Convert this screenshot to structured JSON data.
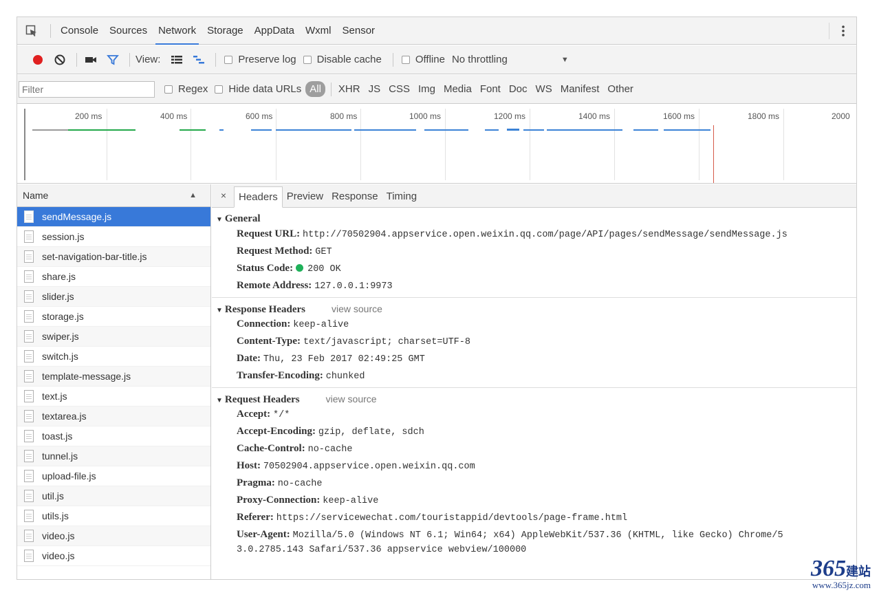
{
  "tabs": [
    {
      "label": "Console"
    },
    {
      "label": "Sources"
    },
    {
      "label": "Network"
    },
    {
      "label": "Storage"
    },
    {
      "label": "AppData"
    },
    {
      "label": "Wxml"
    },
    {
      "label": "Sensor"
    }
  ],
  "toolbar": {
    "view_label": "View:",
    "preserve_log": "Preserve log",
    "disable_cache": "Disable cache",
    "offline": "Offline",
    "throttling": "No throttling"
  },
  "filterbar": {
    "placeholder": "Filter",
    "regex": "Regex",
    "hide_data_urls": "Hide data URLs",
    "types": [
      "All",
      "XHR",
      "JS",
      "CSS",
      "Img",
      "Media",
      "Font",
      "Doc",
      "WS",
      "Manifest",
      "Other"
    ]
  },
  "overview": {
    "ticks": [
      "200 ms",
      "400 ms",
      "600 ms",
      "800 ms",
      "1000 ms",
      "1200 ms",
      "1400 ms",
      "1600 ms",
      "1800 ms",
      "2000"
    ]
  },
  "list": {
    "header": "Name",
    "files": [
      "sendMessage.js",
      "session.js",
      "set-navigation-bar-title.js",
      "share.js",
      "slider.js",
      "storage.js",
      "swiper.js",
      "switch.js",
      "template-message.js",
      "text.js",
      "textarea.js",
      "toast.js",
      "tunnel.js",
      "upload-file.js",
      "util.js",
      "utils.js",
      "video.js",
      "video.js"
    ]
  },
  "details": {
    "tabs": [
      "Headers",
      "Preview",
      "Response",
      "Timing"
    ],
    "general": {
      "title": "General",
      "request_url_key": "Request URL:",
      "request_url": "http://70502904.appservice.open.weixin.qq.com/page/API/pages/sendMessage/sendMessage.js",
      "method_key": "Request Method:",
      "method": "GET",
      "status_key": "Status Code:",
      "status": "200 OK",
      "remote_key": "Remote Address:",
      "remote": "127.0.0.1:9973"
    },
    "response_headers": {
      "title": "Response Headers",
      "view_source": "view source",
      "items": [
        {
          "k": "Connection:",
          "v": "keep-alive"
        },
        {
          "k": "Content-Type:",
          "v": "text/javascript; charset=UTF-8"
        },
        {
          "k": "Date:",
          "v": "Thu, 23 Feb 2017 02:49:25 GMT"
        },
        {
          "k": "Transfer-Encoding:",
          "v": "chunked"
        }
      ]
    },
    "request_headers": {
      "title": "Request Headers",
      "view_source": "view source",
      "items": [
        {
          "k": "Accept:",
          "v": "*/*"
        },
        {
          "k": "Accept-Encoding:",
          "v": "gzip, deflate, sdch"
        },
        {
          "k": "Cache-Control:",
          "v": "no-cache"
        },
        {
          "k": "Host:",
          "v": "70502904.appservice.open.weixin.qq.com"
        },
        {
          "k": "Pragma:",
          "v": "no-cache"
        },
        {
          "k": "Proxy-Connection:",
          "v": "keep-alive"
        },
        {
          "k": "Referer:",
          "v": "https://servicewechat.com/touristappid/devtools/page-frame.html"
        },
        {
          "k": "User-Agent:",
          "v": "Mozilla/5.0 (Windows NT 6.1; Win64; x64) AppleWebKit/537.36 (KHTML, like Gecko) Chrome/5"
        }
      ],
      "ua_continuation": "3.0.2785.143 Safari/537.36 appservice webview/100000"
    }
  },
  "watermark": {
    "number": "365",
    "chinese": "建站",
    "url": "www.365jz.com"
  },
  "colors": {
    "accent": "#3879d9",
    "record": "#e02020",
    "status_ok": "#1fb15a",
    "bar_green": "#22a84a",
    "bar_blue": "#3b82d6"
  },
  "icons": {
    "inspect": "inspect-element-icon",
    "record": "record-icon",
    "clear": "clear-icon",
    "screenshot": "camera-icon",
    "filter": "filter-icon",
    "list_view": "list-view-icon",
    "waterfall": "waterfall-view-icon",
    "more": "more-vertical-icon"
  }
}
